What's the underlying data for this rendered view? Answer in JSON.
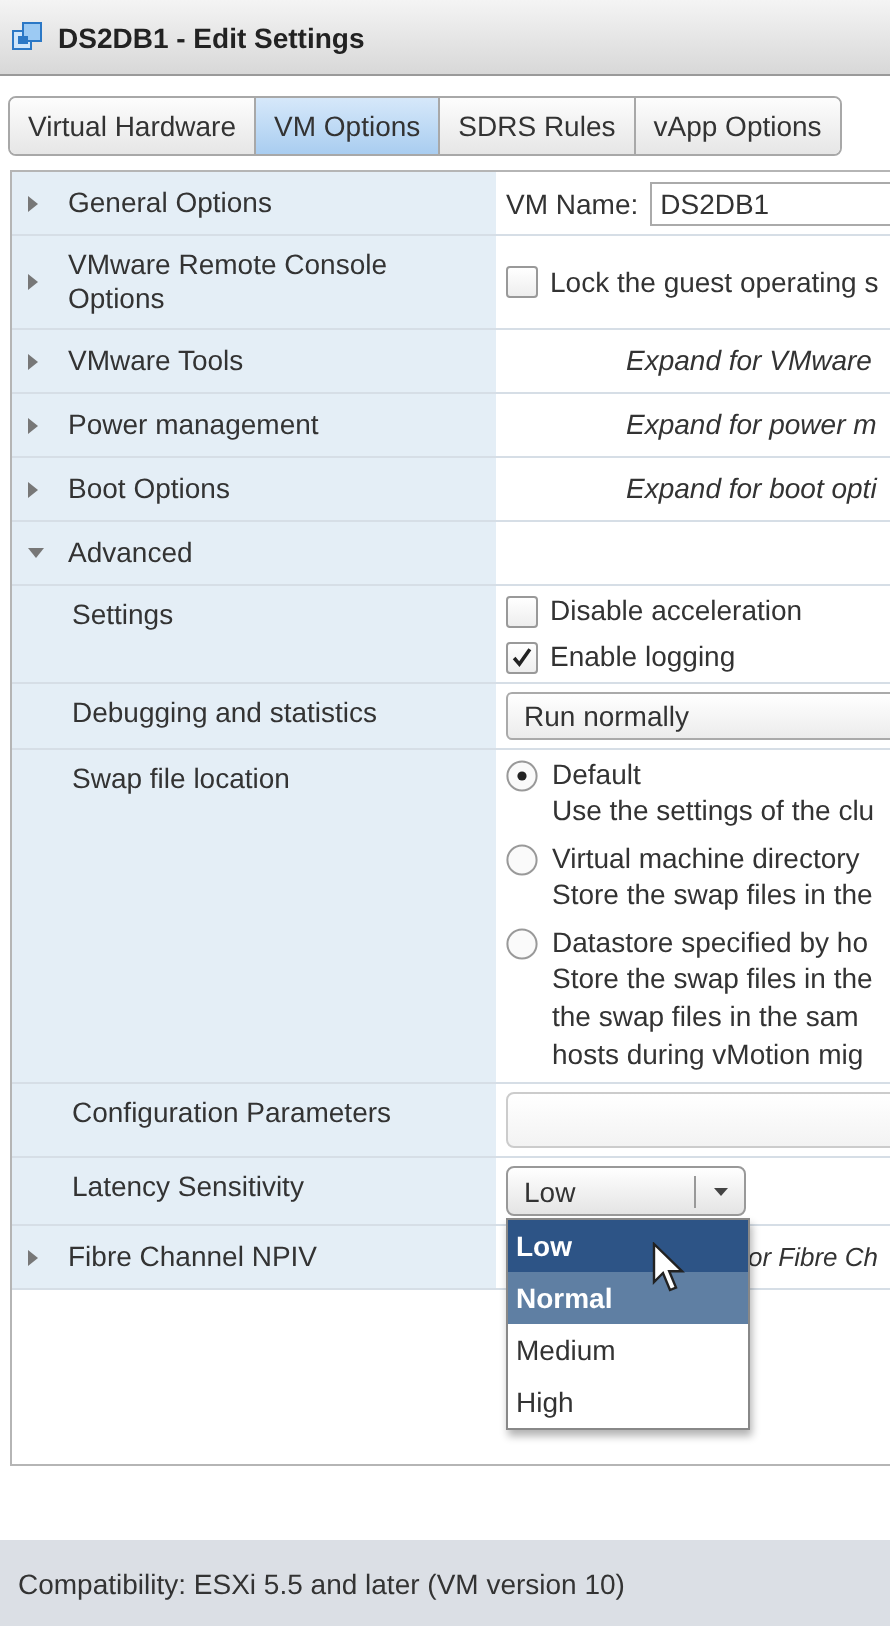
{
  "window": {
    "title": "DS2DB1 - Edit Settings"
  },
  "tabs": [
    {
      "label": "Virtual Hardware",
      "selected": false
    },
    {
      "label": "VM Options",
      "selected": true
    },
    {
      "label": "SDRS Rules",
      "selected": false
    },
    {
      "label": "vApp Options",
      "selected": false
    }
  ],
  "rows": [
    {
      "label": "General Options",
      "expanded": false,
      "content": [
        {
          "kind": "labeled_field",
          "label": "VM Name:",
          "value": "DS2DB1"
        }
      ]
    },
    {
      "label": "VMware Remote Console Options",
      "expanded": false,
      "content": [
        {
          "kind": "checkbox",
          "label": "Lock the guest operating s",
          "checked": false
        }
      ]
    },
    {
      "label": "VMware Tools",
      "expanded": false,
      "content": [
        {
          "kind": "hint",
          "text": "Expand for VMware"
        }
      ]
    },
    {
      "label": "Power management",
      "expanded": false,
      "content": [
        {
          "kind": "hint",
          "text": "Expand for power m"
        }
      ]
    },
    {
      "label": "Boot Options",
      "expanded": false,
      "content": [
        {
          "kind": "hint",
          "text": "Expand for boot opti"
        }
      ]
    },
    {
      "label": "Advanced",
      "expanded": true,
      "content": []
    },
    {
      "label": "Settings",
      "content": [
        {
          "kind": "checkbox",
          "label": "Disable acceleration",
          "checked": false
        },
        {
          "kind": "checkbox",
          "label": "Enable logging",
          "checked": true
        }
      ]
    },
    {
      "label": "Debugging and statistics",
      "content": [
        {
          "kind": "select",
          "value": "Run normally"
        }
      ]
    },
    {
      "label": "Swap file location",
      "content": [
        {
          "kind": "radio",
          "label": "Default",
          "selected": true,
          "description": [
            "Use the settings of the clu"
          ]
        },
        {
          "kind": "radio",
          "label": "Virtual machine directory",
          "selected": false,
          "description": [
            "Store the swap files in the"
          ]
        },
        {
          "kind": "radio",
          "label": "Datastore specified by ho",
          "selected": false,
          "description": [
            "Store the swap files in the",
            "the swap files in the sam",
            "hosts during vMotion mig"
          ]
        }
      ]
    },
    {
      "label": "Configuration Parameters",
      "content": [
        {
          "kind": "button"
        }
      ]
    },
    {
      "label": "Latency Sensitivity",
      "content": [
        {
          "kind": "dropdown",
          "value": "Low",
          "open": true,
          "options": [
            {
              "label": "Low",
              "selected": true,
              "hovered": false
            },
            {
              "label": "Normal",
              "selected": false,
              "hovered": true
            },
            {
              "label": "Medium",
              "selected": false,
              "hovered": false
            },
            {
              "label": "High",
              "selected": false,
              "hovered": false
            }
          ]
        }
      ]
    },
    {
      "label": "Fibre Channel NPIV",
      "expanded": false,
      "content": [
        {
          "kind": "hint_beside_menu",
          "text": "or Fibre Ch"
        }
      ]
    }
  ],
  "footer": {
    "compatibility": "Compatibility: ESXi 5.5 and later (VM version 10)"
  }
}
